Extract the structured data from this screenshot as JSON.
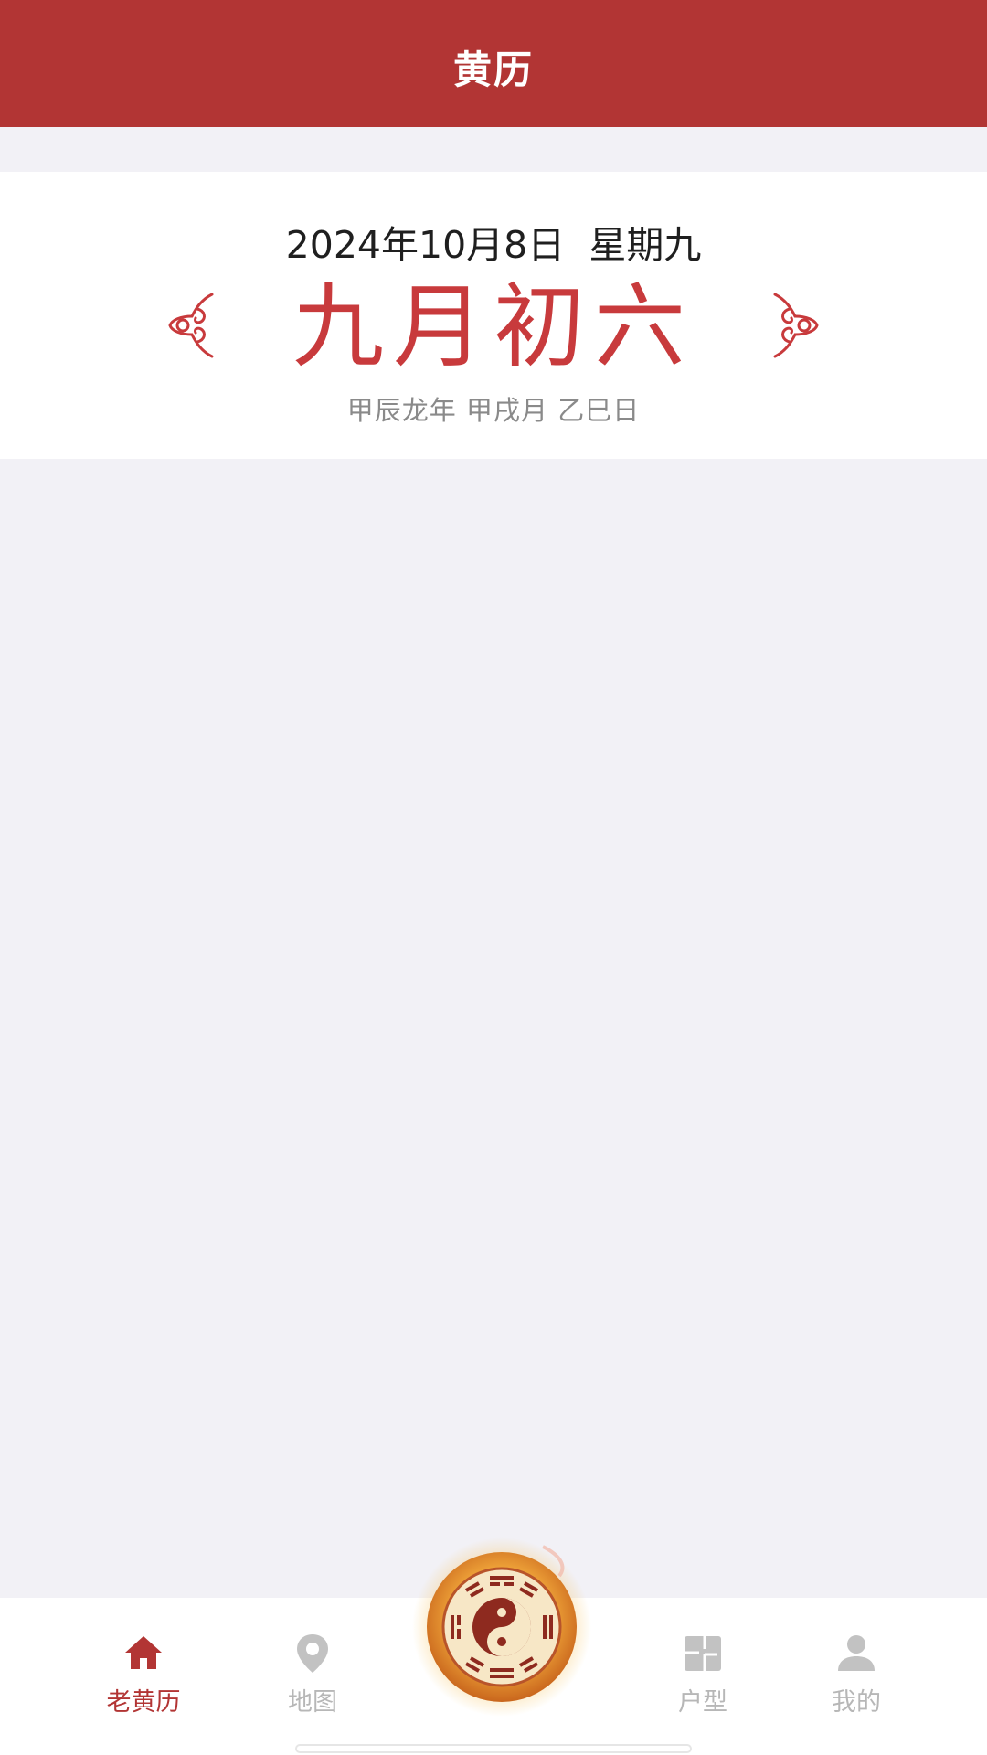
{
  "header": {
    "title": "黄历"
  },
  "date_card": {
    "solar_date": "2024年10月8日  星期九",
    "lunar_date": "九月初六",
    "ganzhi": "甲辰龙年 甲戌月 乙巳日",
    "ornament_icon": "cloud-scroll-ornament-icon"
  },
  "bottom_nav": {
    "items": [
      {
        "label": "老黄历",
        "icon": "home-icon",
        "active": true
      },
      {
        "label": "地图",
        "icon": "map-pin-icon",
        "active": false
      },
      {
        "label": "户型",
        "icon": "floorplan-icon",
        "active": false
      },
      {
        "label": "我的",
        "icon": "person-icon",
        "active": false
      }
    ],
    "center_icon": "bagua-yinyang-icon"
  },
  "colors": {
    "brand": "#b23534",
    "lunar_text": "#c83a3c",
    "background": "#f2f1f6",
    "inactive": "#b7b7b7"
  }
}
